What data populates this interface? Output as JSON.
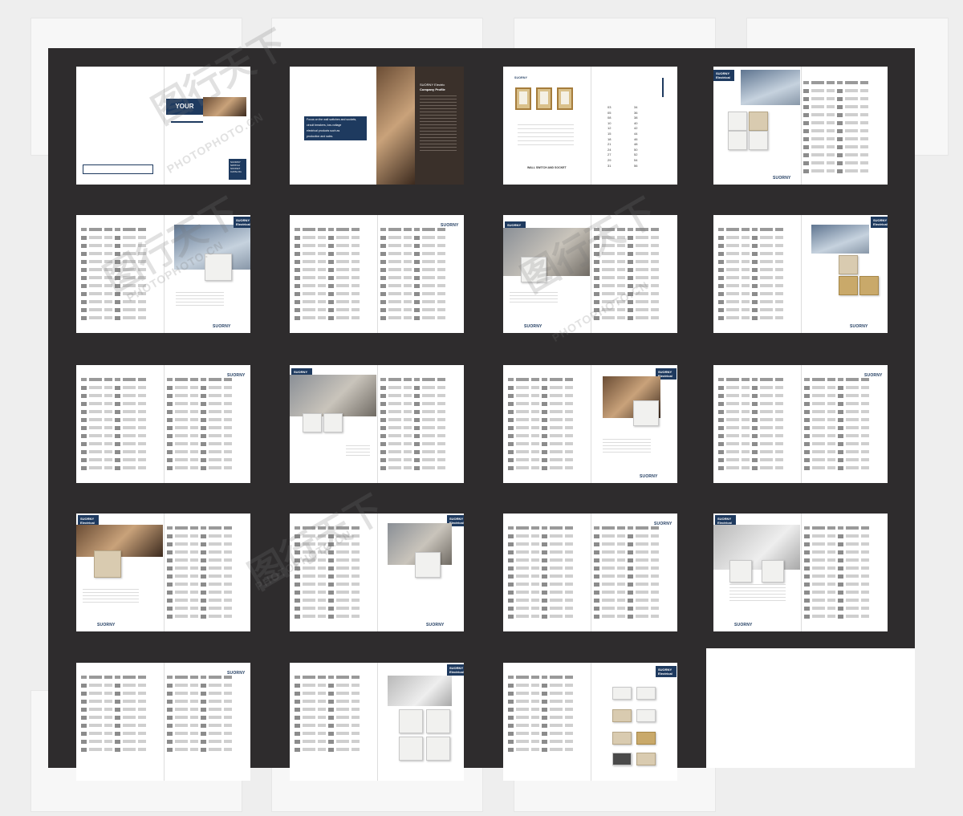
{
  "brand": "SUORNY",
  "cover": {
    "title": "YOUR",
    "box_text": "SUORNY SWITCH SOCKET CATALOG"
  },
  "intro": {
    "tagline_lines": [
      "Focus on the wall switches and sockets,",
      "circuit breakers, low-voltage",
      "electrical products such as",
      "production and sales."
    ],
    "profile_title": "SUORNY Electric",
    "profile_subtitle": "Company Profile"
  },
  "contents": {
    "caption": "WALL SWITCH AND SOCKET",
    "page_numbers": [
      "03",
      "05",
      "08",
      "10",
      "12",
      "15",
      "18",
      "21",
      "24",
      "27",
      "29",
      "31",
      "34",
      "36",
      "38",
      "40",
      "42",
      "44",
      "46",
      "48",
      "50",
      "52",
      "54",
      "56"
    ]
  },
  "tag_label": "SUORNY Electrical",
  "watermark": {
    "glyphs": "图行天下",
    "url": "PHOTOPHOTO.CN"
  },
  "colors": {
    "sheet_background": "#2e2c2d",
    "accent_navy": "#1e3a5f",
    "page_white": "#ffffff"
  }
}
